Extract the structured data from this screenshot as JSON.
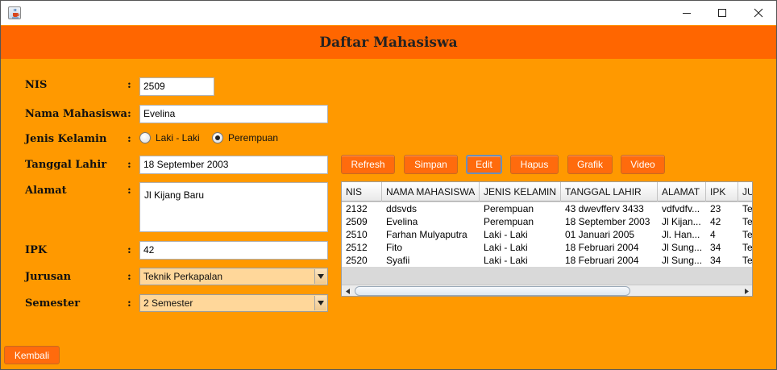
{
  "window": {
    "title": ""
  },
  "header": {
    "title": "Daftar Mahasiswa"
  },
  "form": {
    "nis": {
      "label": "NIS",
      "value": "2509"
    },
    "nama": {
      "label": "Nama Mahasiswa",
      "value": "Evelina"
    },
    "jenis_kelamin": {
      "label": "Jenis Kelamin",
      "options": [
        "Laki - Laki",
        "Perempuan"
      ],
      "selected": "Perempuan"
    },
    "tanggal_lahir": {
      "label": "Tanggal Lahir",
      "value": "18 September 2003"
    },
    "alamat": {
      "label": "Alamat",
      "value": "Jl Kijang Baru"
    },
    "ipk": {
      "label": "IPK",
      "value": "42"
    },
    "jurusan": {
      "label": "Jurusan",
      "value": "Teknik Perkapalan"
    },
    "semester": {
      "label": "Semester",
      "value": "2 Semester"
    },
    "colon": ":"
  },
  "actions": {
    "refresh": "Refresh",
    "simpan": "Simpan",
    "edit": "Edit",
    "hapus": "Hapus",
    "grafik": "Grafik",
    "video": "Video"
  },
  "table": {
    "headers": [
      "NIS",
      "NAMA MAHASISWA",
      "JENIS KELAMIN",
      "TANGGAL LAHIR",
      "ALAMAT",
      "IPK",
      "JU"
    ],
    "rows": [
      [
        "2132",
        "ddsvds",
        "Perempuan",
        "43 dwevfferv 3433",
        "vdfvdfv...",
        "23",
        "Te"
      ],
      [
        "2509",
        "Evelina",
        "Perempuan",
        "18 September 2003",
        "Jl Kijan...",
        "42",
        "Te"
      ],
      [
        "2510",
        "Farhan Mulyaputra",
        "Laki - Laki",
        "01 Januari 2005",
        "Jl. Han...",
        "4",
        "Te"
      ],
      [
        "2512",
        "Fito",
        "Laki - Laki",
        "18 Februari 2004",
        "Jl Sung...",
        "34",
        "Te"
      ],
      [
        "2520",
        "Syafii",
        "Laki - Laki",
        "18 Februari 2004",
        "Jl Sung...",
        "34",
        "Te"
      ]
    ]
  },
  "footer": {
    "back": "Kembali"
  },
  "icons": {
    "app": "java-cup-icon",
    "minimize": "minimize-icon",
    "maximize": "maximize-icon",
    "close": "close-icon",
    "dropdown": "triangle-down-icon",
    "scroll_left": "triangle-left-icon",
    "scroll_right": "triangle-right-icon"
  },
  "colors": {
    "background": "#ff9900",
    "header": "#ff6600",
    "button": "#ff6b0d",
    "combo": "#ffd79a"
  }
}
